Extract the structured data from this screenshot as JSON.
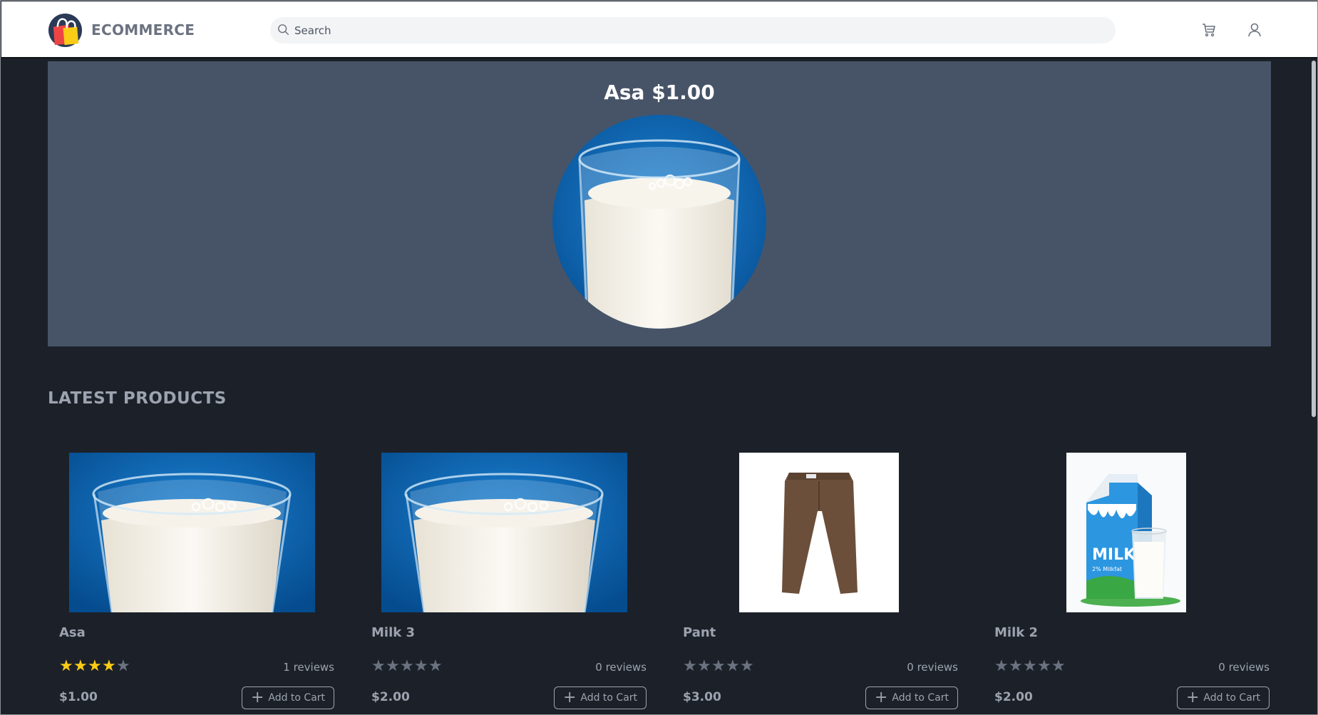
{
  "header": {
    "brand": "ECOMMERCE",
    "search_placeholder": "Search",
    "icons": {
      "cart": "cart-icon",
      "user": "user-icon",
      "search": "search-icon",
      "logo": "shopping-bag-logo"
    }
  },
  "hero": {
    "title": "Asa $1.00",
    "image": "glass-of-milk"
  },
  "section": {
    "title": "LATEST PRODUCTS"
  },
  "products": [
    {
      "name": "Asa",
      "rating": 4,
      "max_rating": 5,
      "reviews": "1 reviews",
      "price": "$1.00",
      "add_label": "Add to Cart",
      "image": "glass-of-milk"
    },
    {
      "name": "Milk 3",
      "rating": 0,
      "max_rating": 5,
      "reviews": "0 reviews",
      "price": "$2.00",
      "add_label": "Add to Cart",
      "image": "glass-of-milk"
    },
    {
      "name": "Pant",
      "rating": 0,
      "max_rating": 5,
      "reviews": "0 reviews",
      "price": "$3.00",
      "add_label": "Add to Cart",
      "image": "brown-pants"
    },
    {
      "name": "Milk 2",
      "rating": 0,
      "max_rating": 5,
      "reviews": "0 reviews",
      "price": "$2.00",
      "add_label": "Add to Cart",
      "image": "milk-carton-and-glass"
    }
  ],
  "colors": {
    "background": "#1c2129",
    "hero": "#475467",
    "star_filled": "#facc15",
    "star_empty": "#6b7280",
    "milk_blue": "#0a67b3"
  },
  "milk_carton": {
    "label": "MILK",
    "sublabel": "2% Milkfat"
  }
}
